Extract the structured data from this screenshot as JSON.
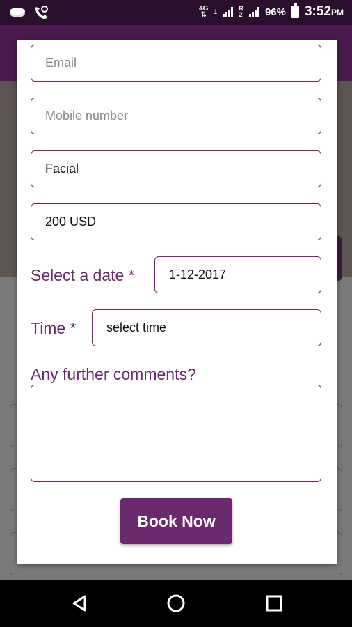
{
  "status_bar": {
    "network_top": "4G",
    "network_bottom": "1",
    "roaming": "R",
    "sim2": "2",
    "battery": "96%",
    "time": "3:52",
    "ampm": "PM"
  },
  "form": {
    "email_placeholder": "Email",
    "mobile_placeholder": "Mobile number",
    "service_value": "Facial",
    "price_value": "200 USD",
    "date_label": "Select a date *",
    "date_value": "1-12-2017",
    "time_label": "Time *",
    "time_value": "select time",
    "comments_label": "Any further comments?",
    "comments_value": "",
    "submit_label": "Book Now"
  },
  "colors": {
    "accent": "#6b2a6d",
    "status_bar": "#2a0f2c",
    "overlay": "#7a7a7a"
  },
  "icons": {
    "status_left": [
      "message-icon",
      "phone-icon"
    ],
    "nav": [
      "back-icon",
      "home-icon",
      "recents-icon"
    ]
  }
}
